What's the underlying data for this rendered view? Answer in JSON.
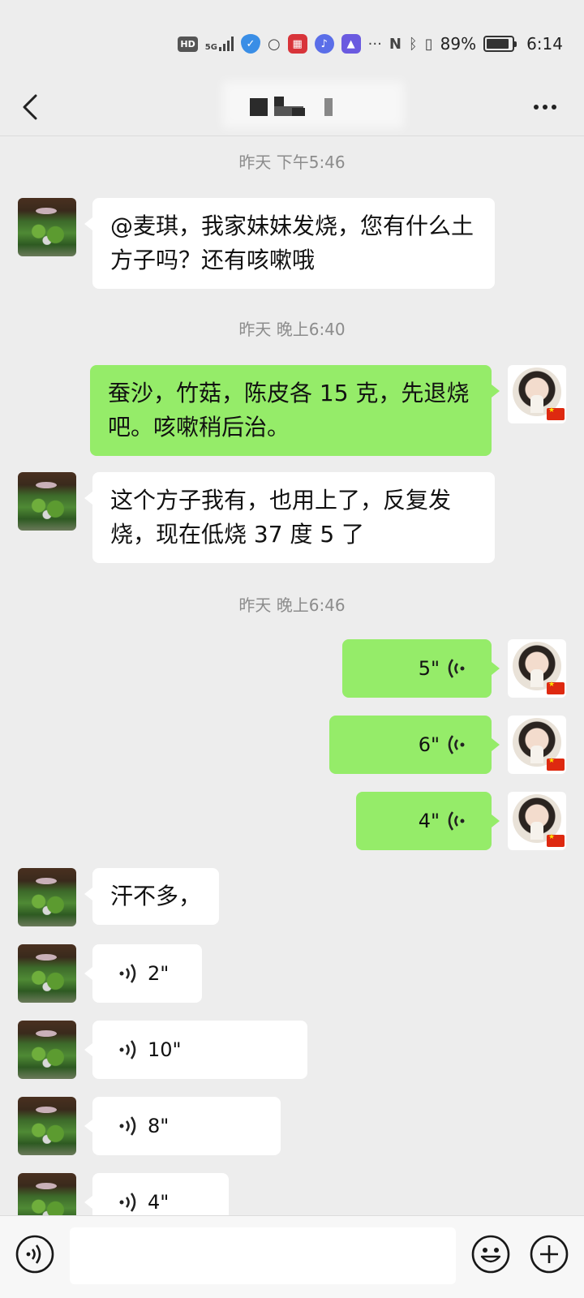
{
  "status_bar": {
    "network_badge": "HD",
    "network_type": "5G",
    "battery_percent": "89%",
    "battery_level": 0.89,
    "time": "6:14",
    "icons": [
      "hd-icon",
      "5g-signal-icon",
      "shield-app-icon",
      "chat-app-icon",
      "app-icon",
      "music-app-icon",
      "education-app-icon",
      "more-icon",
      "nfc-icon",
      "bluetooth-icon",
      "vibrate-icon",
      "battery-icon"
    ],
    "more_dots": "···"
  },
  "header": {
    "back_icon": "chevron-left-icon",
    "title": "",
    "more_icon": "more-dots-icon"
  },
  "timestamps": [
    "昨天 下午5:46",
    "昨天 晚上6:40",
    "昨天 晚上6:46"
  ],
  "messages": [
    {
      "side": "in",
      "type": "text",
      "text": "@麦琪，我家妹妹发烧，您有什么土方子吗？还有咳嗽哦"
    },
    {
      "side": "out",
      "type": "text",
      "text": "蚕沙，竹菇，陈皮各 15 克，先退烧吧。咳嗽稍后治。"
    },
    {
      "side": "in",
      "type": "text",
      "text": "这个方子我有，也用上了，反复发烧，现在低烧 37 度 5 了"
    },
    {
      "side": "out",
      "type": "voice",
      "duration": "5\""
    },
    {
      "side": "out",
      "type": "voice",
      "duration": "6\""
    },
    {
      "side": "out",
      "type": "voice",
      "duration": "4\""
    },
    {
      "side": "in",
      "type": "text",
      "text": "汗不多，"
    },
    {
      "side": "in",
      "type": "voice",
      "duration": "2\""
    },
    {
      "side": "in",
      "type": "voice",
      "duration": "10\""
    },
    {
      "side": "in",
      "type": "voice",
      "duration": "8\""
    },
    {
      "side": "in",
      "type": "voice",
      "duration": "4\""
    }
  ],
  "input_bar": {
    "voice_icon": "voice-input-icon",
    "placeholder": "",
    "emoji_icon": "emoji-icon",
    "plus_icon": "plus-icon"
  },
  "colors": {
    "background": "#ededed",
    "outgoing_bubble": "#95ec69",
    "incoming_bubble": "#ffffff",
    "timestamp_text": "#8c8c8c"
  }
}
